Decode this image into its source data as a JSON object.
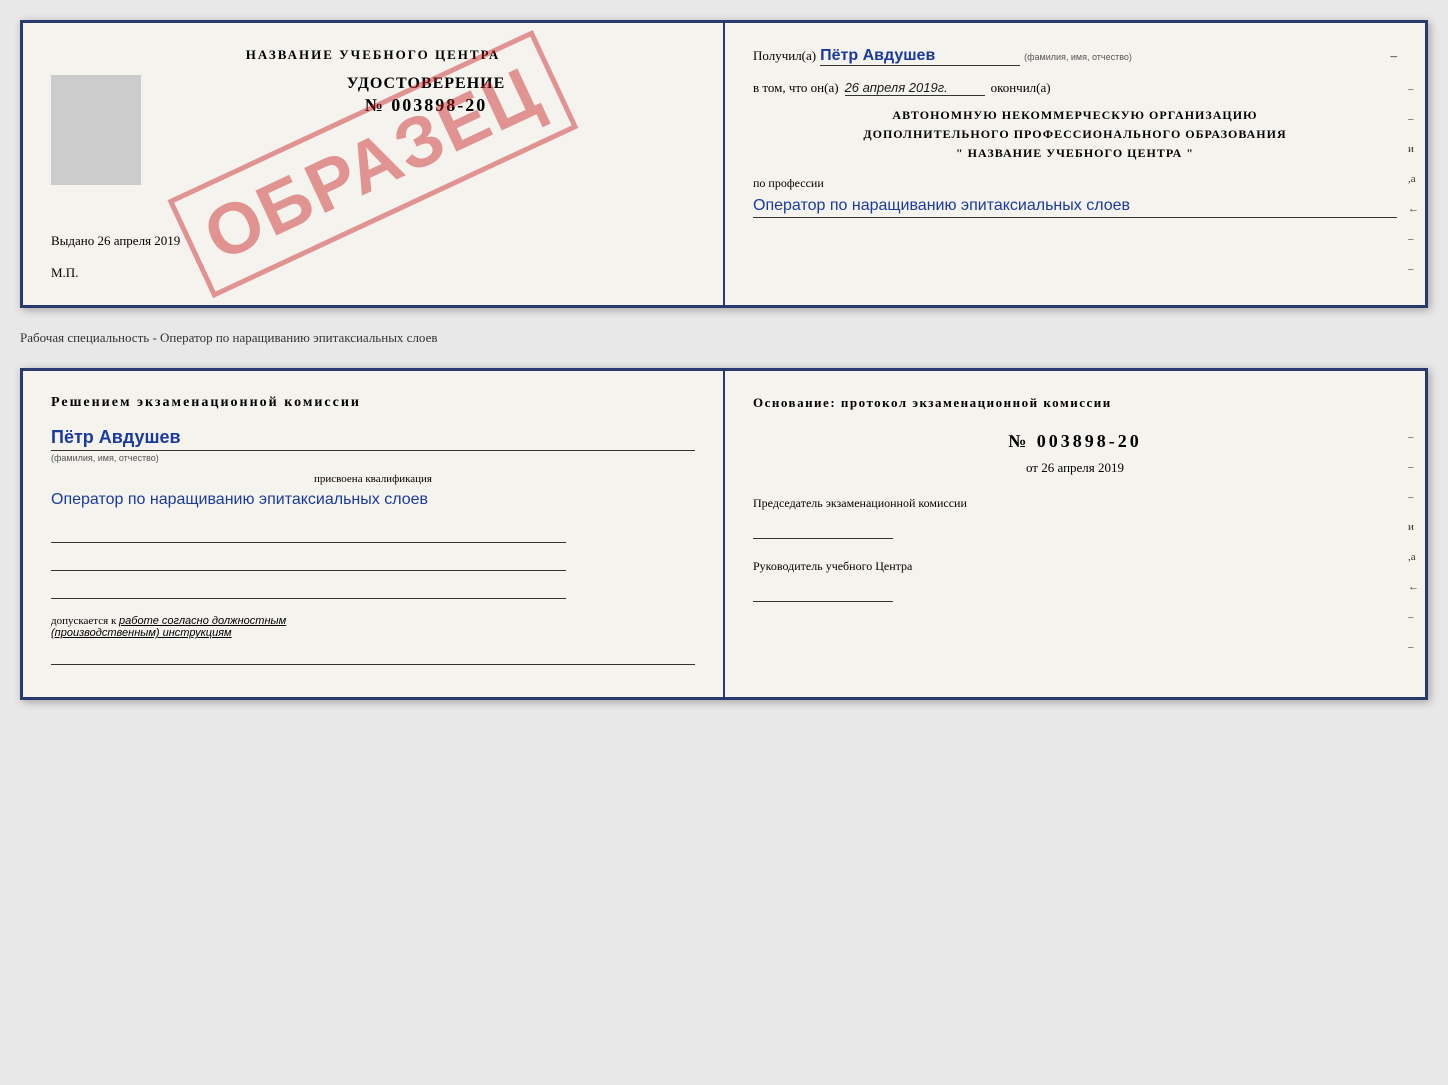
{
  "page": {
    "bg_color": "#e8e8e8"
  },
  "certificate": {
    "left": {
      "title": "НАЗВАНИЕ УЧЕБНОГО ЦЕНТРА",
      "stamp": "ОБРАЗЕЦ",
      "udostoverenie_label": "УДОСТОВЕРЕНИЕ",
      "number": "№ 003898-20",
      "vydano_label": "Выдано",
      "vydano_date": "26 апреля 2019",
      "mp_label": "М.П."
    },
    "right": {
      "poluchil_prefix": "Получил(а)",
      "poluchil_name": "Пётр Авдушев",
      "fio_hint": "(фамилия, имя, отчество)",
      "dash": "–",
      "vtom_prefix": "в том, что он(а)",
      "vtom_date": "26 апреля 2019г.",
      "okonchil": "окончил(а)",
      "org_line1": "АВТОНОМНУЮ НЕКОММЕРЧЕСКУЮ ОРГАНИЗАЦИЮ",
      "org_line2": "ДОПОЛНИТЕЛЬНОГО ПРОФЕССИОНАЛЬНОГО ОБРАЗОВАНИЯ",
      "org_quote": "\"  НАЗВАНИЕ УЧЕБНОГО ЦЕНТРА  \"",
      "profession_label": "по профессии",
      "profession_value": "Оператор по наращиванию эпитаксиальных слоев",
      "side_dashes": [
        "–",
        "–",
        "и",
        ",а",
        "←",
        "–",
        "–"
      ]
    }
  },
  "separator": {
    "text": "Рабочая специальность - Оператор по наращиванию эпитаксиальных слоев"
  },
  "qualification": {
    "left": {
      "resheniem_title": "Решением  экзаменационной  комиссии",
      "person_name": "Пётр Авдушев",
      "fio_hint": "(фамилия, имя, отчество)",
      "prisvoena_label": "присвоена квалификация",
      "profession_value": "Оператор по наращиванию эпитаксиальных слоев",
      "dopusk_label": "допускается к",
      "dopusk_value": "работе согласно должностным (производственным) инструкциям"
    },
    "right": {
      "osnovanie_title": "Основание: протокол экзаменационной  комиссии",
      "protocol_number": "№  003898-20",
      "protocol_date_prefix": "от",
      "protocol_date": "26 апреля 2019",
      "predsedatel_label": "Председатель экзаменационной комиссии",
      "rukovoditel_label": "Руководитель учебного Центра",
      "side_dashes": [
        "–",
        "–",
        "–",
        "и",
        ",а",
        "←",
        "–",
        "–"
      ]
    }
  }
}
